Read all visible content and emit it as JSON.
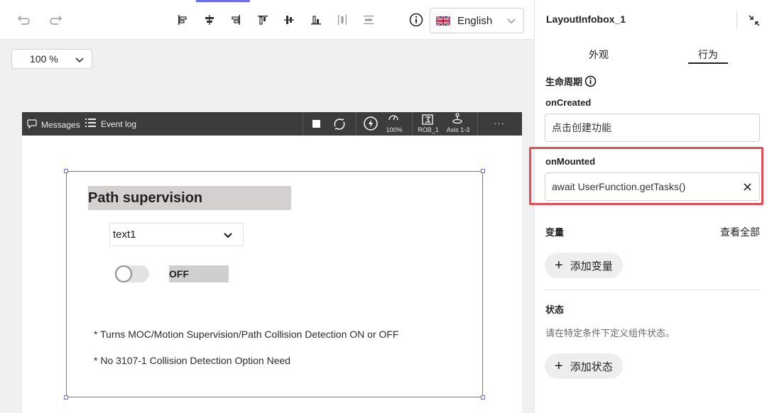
{
  "top_toolbar": {
    "language": "English",
    "language_flag": "uk-flag-icon",
    "icons": [
      "undo-icon",
      "redo-icon",
      "align-left-icon",
      "align-center-h-icon",
      "align-right-icon",
      "align-top-icon",
      "align-middle-v-icon",
      "align-bottom-icon",
      "distribute-h-icon",
      "distribute-v-icon",
      "info-icon"
    ]
  },
  "canvas": {
    "zoom": "100 %"
  },
  "device_bar": {
    "messages": "Messages",
    "event_log": "Event log",
    "speed": "100%",
    "robot": "ROB_1",
    "axis": "Axis 1-3",
    "more": "···"
  },
  "widget": {
    "title": "Path supervision",
    "dropdown_value": "text1",
    "toggle_label": "OFF",
    "note1": "* Turns MOC/Motion Supervision/Path Collision Detection ON or OFF",
    "note2": "* No 3107-1 Collision Detection Option Need"
  },
  "panel": {
    "title": "LayoutInfobox_1",
    "tabs": [
      {
        "label": "外观",
        "active": false
      },
      {
        "label": "行为",
        "active": true
      }
    ],
    "lifecycle_label": "生命周期",
    "on_created_label": "onCreated",
    "on_created_value": "点击创建功能",
    "on_mounted_label": "onMounted",
    "on_mounted_value": "await UserFunction.getTasks()",
    "variables_label": "变量",
    "view_all": "查看全部",
    "add_variable": "添加变量",
    "state_label": "状态",
    "state_desc": "请在特定条件下定义组件状态。",
    "add_state": "添加状态"
  },
  "colors": {
    "selection": "#6a6ad8",
    "highlight": "#e64a52",
    "device_bar": "#3c3c3c"
  }
}
